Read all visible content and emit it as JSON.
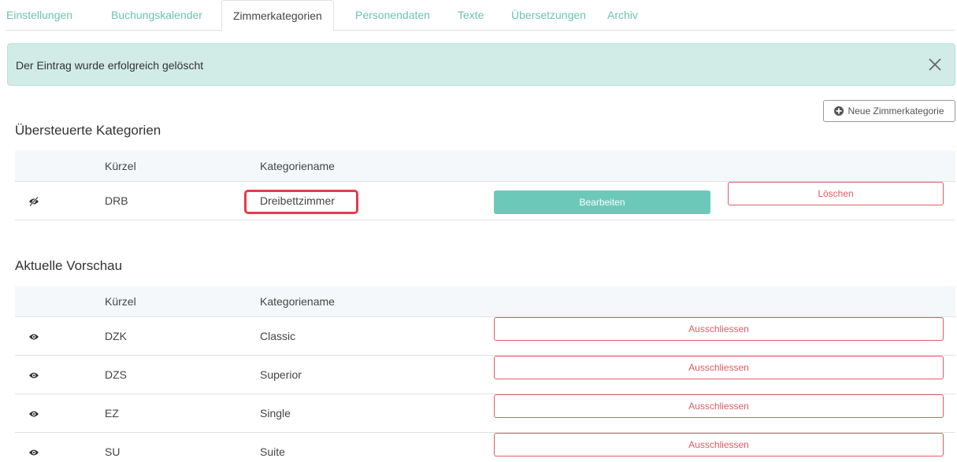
{
  "tabs": [
    {
      "label": "Einstellungen"
    },
    {
      "label": "Buchungskalender"
    },
    {
      "label": "Zimmerkategorien"
    },
    {
      "label": "Personendaten"
    },
    {
      "label": "Texte"
    },
    {
      "label": "Übersetzungen"
    },
    {
      "label": "Archiv"
    }
  ],
  "alert": {
    "message": "Der Eintrag wurde erfolgreich gelöscht"
  },
  "toolbar": {
    "new_category_label": "Neue Zimmerkategorie"
  },
  "overridden": {
    "title": "Übersteuerte Kategorien",
    "columns": {
      "code": "Kürzel",
      "name": "Kategoriename"
    },
    "rows": [
      {
        "code": "DRB",
        "name": "Dreibettzimmer",
        "edit_label": "Bearbeiten",
        "delete_label": "Löschen",
        "visible": false
      }
    ]
  },
  "preview": {
    "title": "Aktuelle Vorschau",
    "columns": {
      "code": "Kürzel",
      "name": "Kategoriename"
    },
    "rows": [
      {
        "code": "DZK",
        "name": "Classic",
        "exclude_label": "Ausschliessen",
        "visible": true
      },
      {
        "code": "DZS",
        "name": "Superior",
        "exclude_label": "Ausschliessen",
        "visible": true
      },
      {
        "code": "EZ",
        "name": "Single",
        "exclude_label": "Ausschliessen",
        "visible": true
      },
      {
        "code": "SU",
        "name": "Suite",
        "exclude_label": "Ausschliessen",
        "visible": true
      }
    ]
  },
  "colors": {
    "accent": "#6cc9b9",
    "danger": "#e15c65",
    "alert_bg": "#d1ebe6",
    "highlight": "#e53b4e"
  },
  "icons": {
    "visible": "eye-icon",
    "hidden": "eye-slash-icon",
    "close": "close-icon",
    "add": "plus-circle-icon"
  }
}
